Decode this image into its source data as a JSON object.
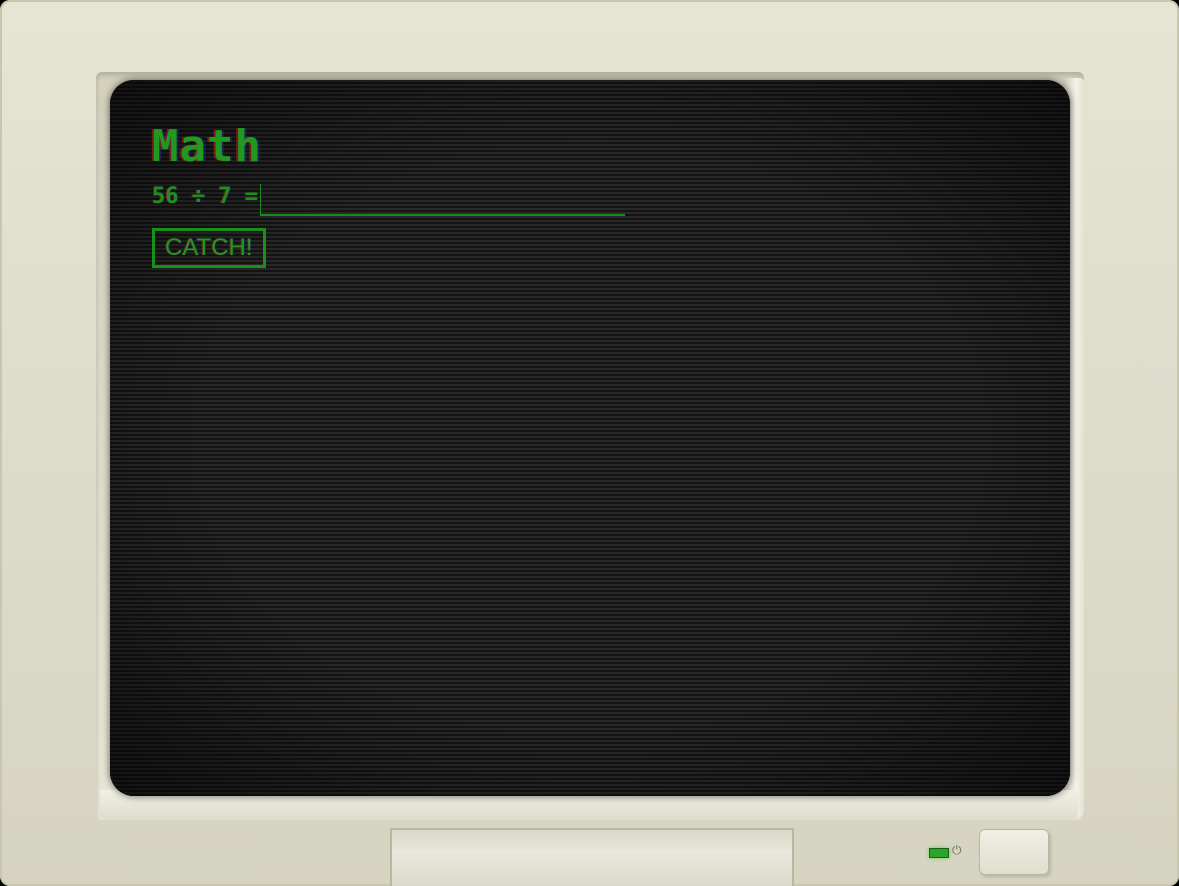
{
  "screen": {
    "title": "Math",
    "question": "56 ÷ 7 =",
    "answer": {
      "value": "",
      "placeholder": ""
    },
    "catch_label": "CATCH!"
  },
  "monitor": {
    "power_icon": "power-icon",
    "power_symbol": "⏻",
    "led_status": "on"
  },
  "colors": {
    "text": "#1f9a1f",
    "screen_bg": "#1b1b1b",
    "bezel": "#e6e4d2",
    "led": "#2aa52a"
  }
}
